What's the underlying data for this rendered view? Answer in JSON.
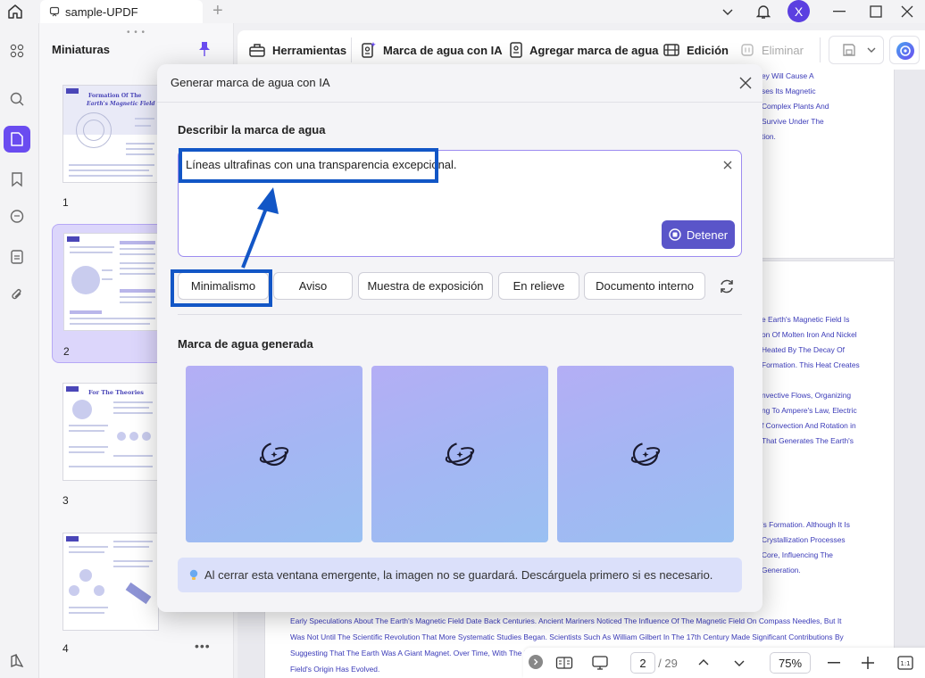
{
  "window": {
    "tab_title": "sample-UPDF",
    "avatar_letter": "X"
  },
  "thumbnails": {
    "title": "Miniaturas",
    "pages": [
      {
        "number": "1",
        "heading_line1": "Formation Of The",
        "heading_line2": "Earth's Magnetic Field"
      },
      {
        "number": "2"
      },
      {
        "number": "3",
        "heading_line1": "For The Theories"
      },
      {
        "number": "4"
      }
    ]
  },
  "toolbar": {
    "tools": "Herramientas",
    "ai_watermark": "Marca de agua con IA",
    "add_watermark": "Agregar marca de agua",
    "edit": "Edición",
    "delete": "Eliminar"
  },
  "document": {
    "page1_lines": [
      "ey Will Cause A",
      "ses Its Magnetic",
      "Complex Plants And",
      "Survive Under The",
      "tion."
    ],
    "page2_lines": [
      "e Earth's Magnetic Field Is",
      "on Of Molten Iron And Nickel",
      "Heated By The Decay Of",
      "Formation. This Heat Creates",
      "nvective Flows, Organizing",
      "ng To Ampere's Law, Electric",
      "f Convection And Rotation in",
      "That Generates The Earth's",
      "'s Formation. Although It Is",
      "Crystallization Processes",
      "Core, Influencing The",
      "Generation."
    ],
    "bottom_lines": [
      "Early Speculations About The Earth's Magnetic Field Date Back Centuries. Ancient Mariners Noticed The Influence Of The Magnetic Field On Compass Needles, But It",
      "Was Not Until The Scientific Revolution That More Systematic Studies Began. Scientists Such As William Gilbert In The 17th Century Made Significant Contributions By",
      "Suggesting That The Earth Was A Giant Magnet. Over Time, With The De",
      "Field's Origin Has Evolved."
    ]
  },
  "bottombar": {
    "current_page": "2",
    "total_pages": "/ 29",
    "zoom": "75%"
  },
  "dialog": {
    "title": "Generar marca de agua con IA",
    "describe_label": "Describir la marca de agua",
    "prompt_value": "Líneas ultrafinas con una transparencia excepcional.",
    "stop_button": "Detener",
    "styles": [
      "Minimalismo",
      "Aviso",
      "Muestra de exposición",
      "En relieve",
      "Documento interno"
    ],
    "generated_label": "Marca de agua generada",
    "notice": "Al cerrar esta ventana emergente, la imagen no se guardará. Descárguela primero si es necesario."
  },
  "colors": {
    "accent": "#6a4cf0",
    "stop_button": "#5a55c9",
    "annotation": "#1256c6",
    "doc_text": "#3a3ab8"
  },
  "icons": [
    "home-icon",
    "document-tab-icon",
    "chevron-down-icon",
    "bell-icon",
    "search-icon",
    "thumbnails-icon",
    "bookmark-icon",
    "comment-icon",
    "form-icon",
    "attachment-icon",
    "toolbox-icon",
    "ai-watermark-icon",
    "watermark-icon",
    "edit-icon",
    "trash-icon",
    "save-icon",
    "ai-assistant-icon",
    "close-icon",
    "stop-icon",
    "refresh-icon",
    "loading-spinner-icon",
    "lightbulb-icon"
  ]
}
